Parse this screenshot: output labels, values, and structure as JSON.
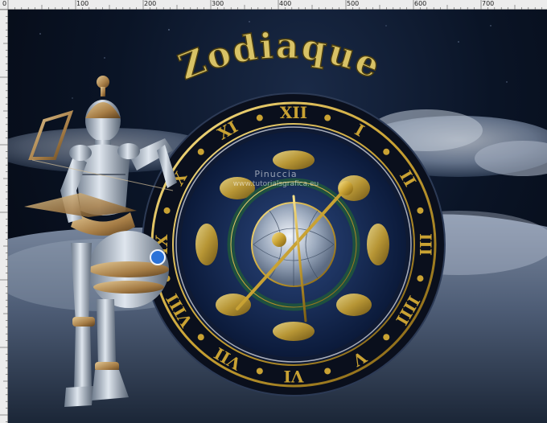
{
  "window": {
    "title": "Zodiaque"
  },
  "ruler": {
    "top_labels": [
      "0",
      "100",
      "200",
      "300",
      "400",
      "500",
      "600",
      "700"
    ],
    "left_labels": [
      "0",
      "100",
      "200",
      "300",
      "400",
      "500"
    ]
  },
  "artwork": {
    "title": "Zodiaque",
    "watermark_name": "Pinuccia",
    "watermark_url": "www.tutorialsgrafica.eu",
    "clock_numerals": [
      "XII",
      "I",
      "II",
      "III",
      "IIII",
      "V",
      "VI",
      "VII",
      "VIII",
      "IX",
      "X",
      "XI"
    ],
    "title_color": "#d8c266",
    "gold_color": "#c9a233",
    "clock_face_color": "#0b1a3a"
  }
}
